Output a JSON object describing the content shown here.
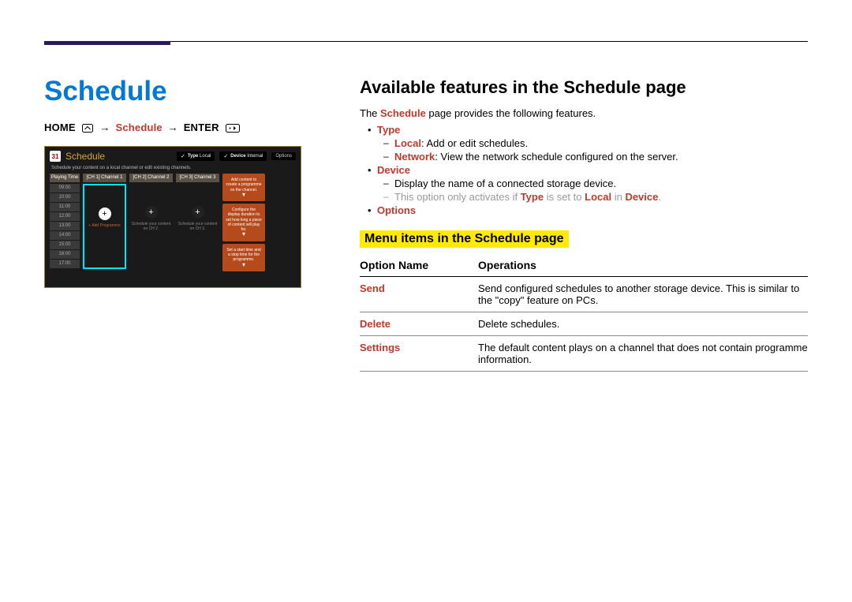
{
  "left": {
    "title": "Schedule",
    "breadcrumb": {
      "home": "HOME",
      "a1": "→",
      "mid": "Schedule",
      "a2": "→",
      "enter": "ENTER"
    }
  },
  "panel": {
    "calendar_glyph": "31",
    "title": "Schedule",
    "chip_type": {
      "label_pre": "Type",
      "value": "Local"
    },
    "chip_device": {
      "label_pre": "Device",
      "value": "Internal"
    },
    "options": "Options",
    "subtitle": "Schedule your content on a local channel or edit existing channels.",
    "time_header": "Playing Time",
    "time_slots": [
      "09:00",
      "10:00",
      "11:00",
      "12:00",
      "13:00",
      "14:00",
      "15:00",
      "16:00",
      "17:00"
    ],
    "cols": [
      {
        "header": "[CH 1] Channel 1",
        "plus_label": "+ Add Programme",
        "active": true
      },
      {
        "header": "[CH 2] Channel 2",
        "plus_label": "Schedule your content on CH 2.",
        "active": false
      },
      {
        "header": "[CH 3] Channel 3",
        "plus_label": "Schedule your content on CH 3.",
        "active": false
      }
    ],
    "info": [
      "Add content to create a programme on the channel.",
      "Configure the display duration to set how long a piece of content will play for.",
      "Set a start time and a stop time for the programme."
    ]
  },
  "right": {
    "heading": "Available features in the Schedule page",
    "intro_pre": "The ",
    "intro_hot": "Schedule",
    "intro_post": " page provides the following features.",
    "features": {
      "type": {
        "title": "Type",
        "local_pre": "Local",
        "local_rest": ": Add or edit schedules.",
        "network_pre": "Network",
        "network_rest": ": View the network schedule configured on the server."
      },
      "device": {
        "title": "Device",
        "line1": "Display the name of a connected storage device.",
        "line2_pre": "This option only activates if ",
        "line2_type": "Type",
        "line2_mid": " is set to ",
        "line2_local": "Local",
        "line2_in": " in ",
        "line2_device": "Device",
        "line2_end": "."
      },
      "options": {
        "title": "Options"
      }
    },
    "menu_heading": "Menu items in the Schedule page",
    "table": {
      "col1": "Option Name",
      "col2": "Operations",
      "rows": [
        {
          "name": "Send",
          "op": "Send configured schedules to another storage device. This is similar to the \"copy\" feature on PCs."
        },
        {
          "name": "Delete",
          "op": "Delete schedules."
        },
        {
          "name": "Settings",
          "op": "The default content plays on a channel that does not contain programme information."
        }
      ]
    }
  }
}
